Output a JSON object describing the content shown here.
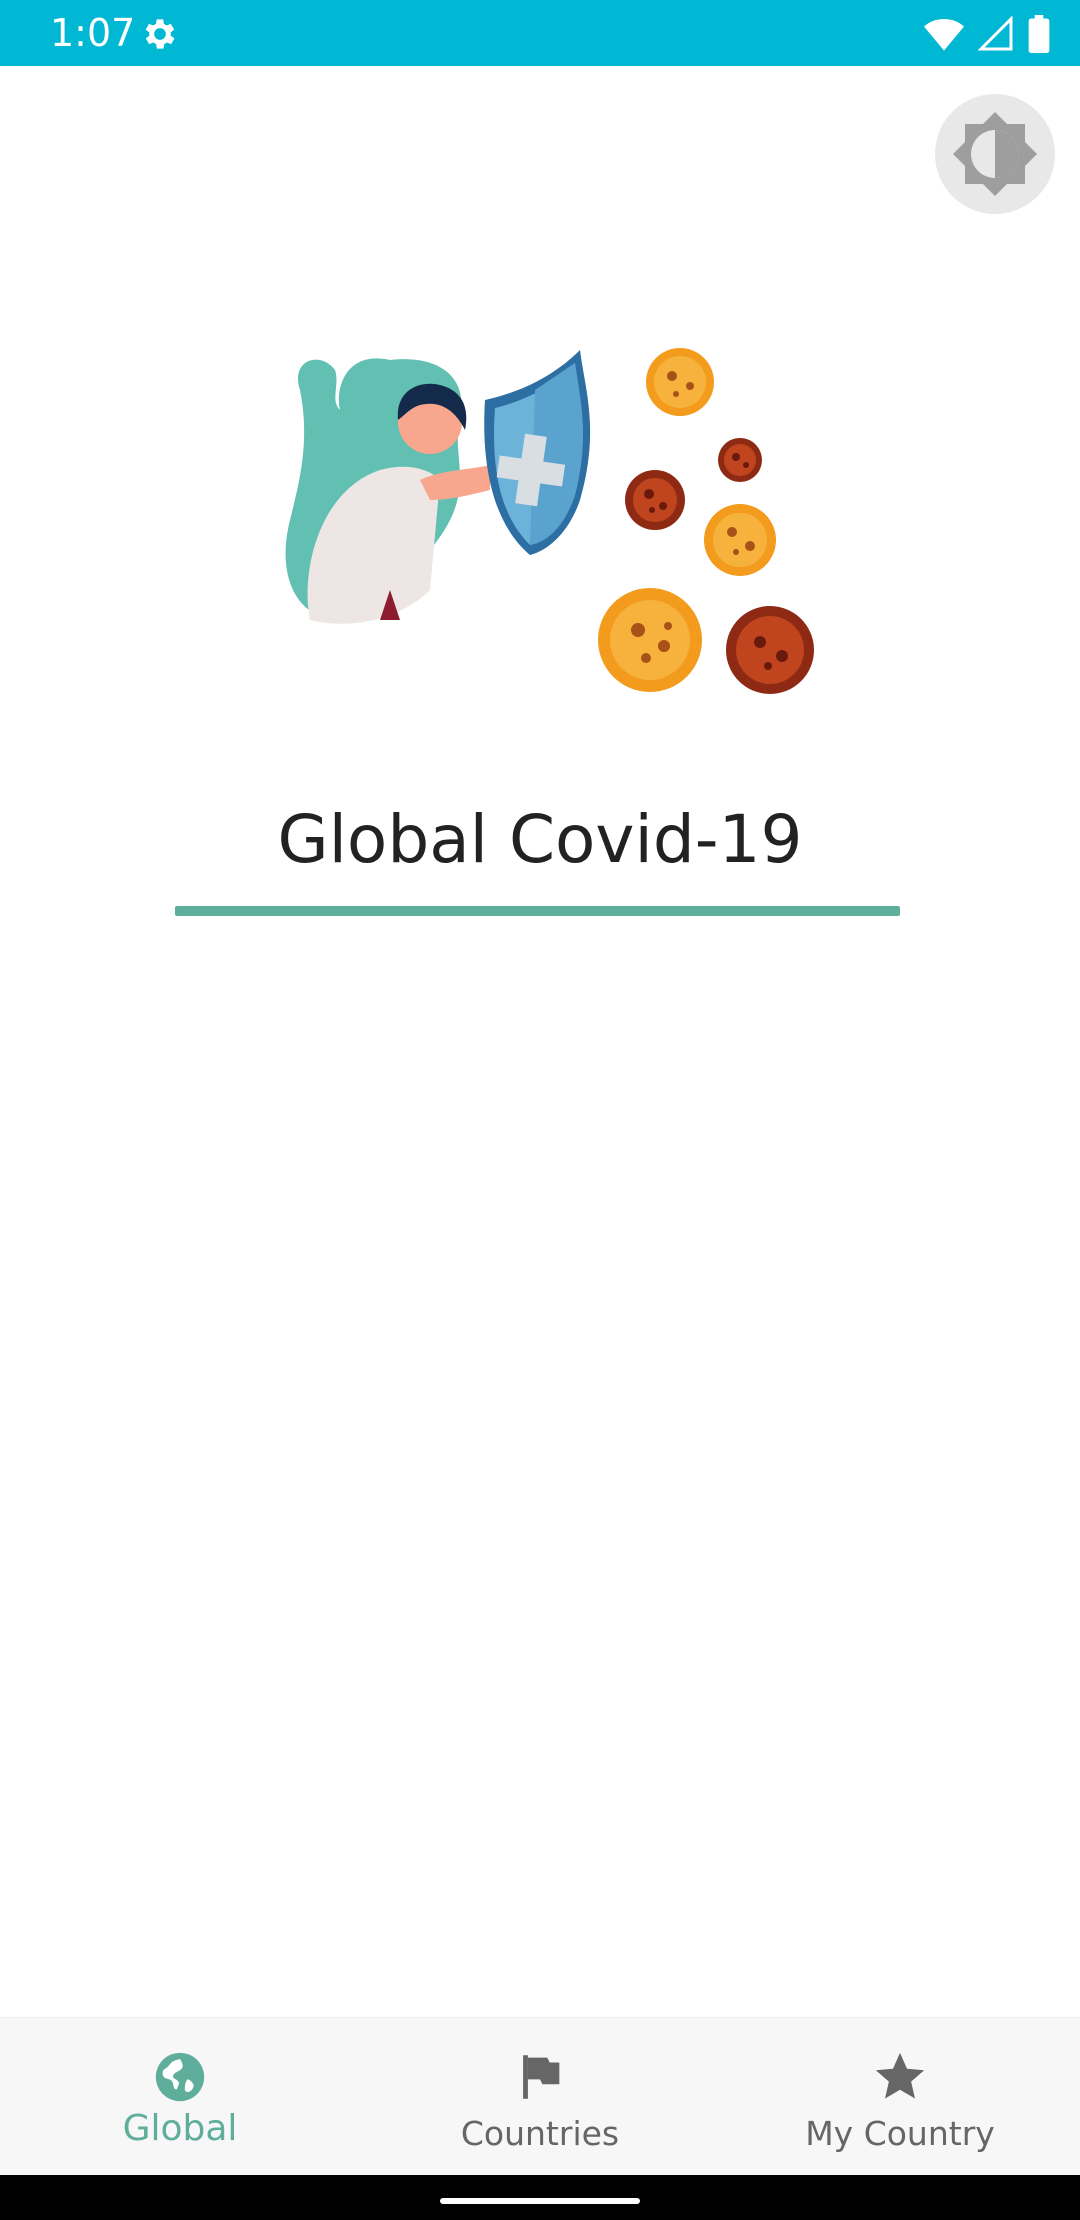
{
  "status_bar": {
    "time": "1:07",
    "background": "#00B8D4"
  },
  "header": {
    "theme_toggle_icon": "brightness-icon"
  },
  "main": {
    "title": "Global Covid-19",
    "accent": "#5FAE9B"
  },
  "bottom_nav": {
    "items": [
      {
        "label": "Global",
        "icon": "globe-icon",
        "active": true
      },
      {
        "label": "Countries",
        "icon": "flag-icon",
        "active": false
      },
      {
        "label": "My Country",
        "icon": "star-icon",
        "active": false
      }
    ]
  }
}
